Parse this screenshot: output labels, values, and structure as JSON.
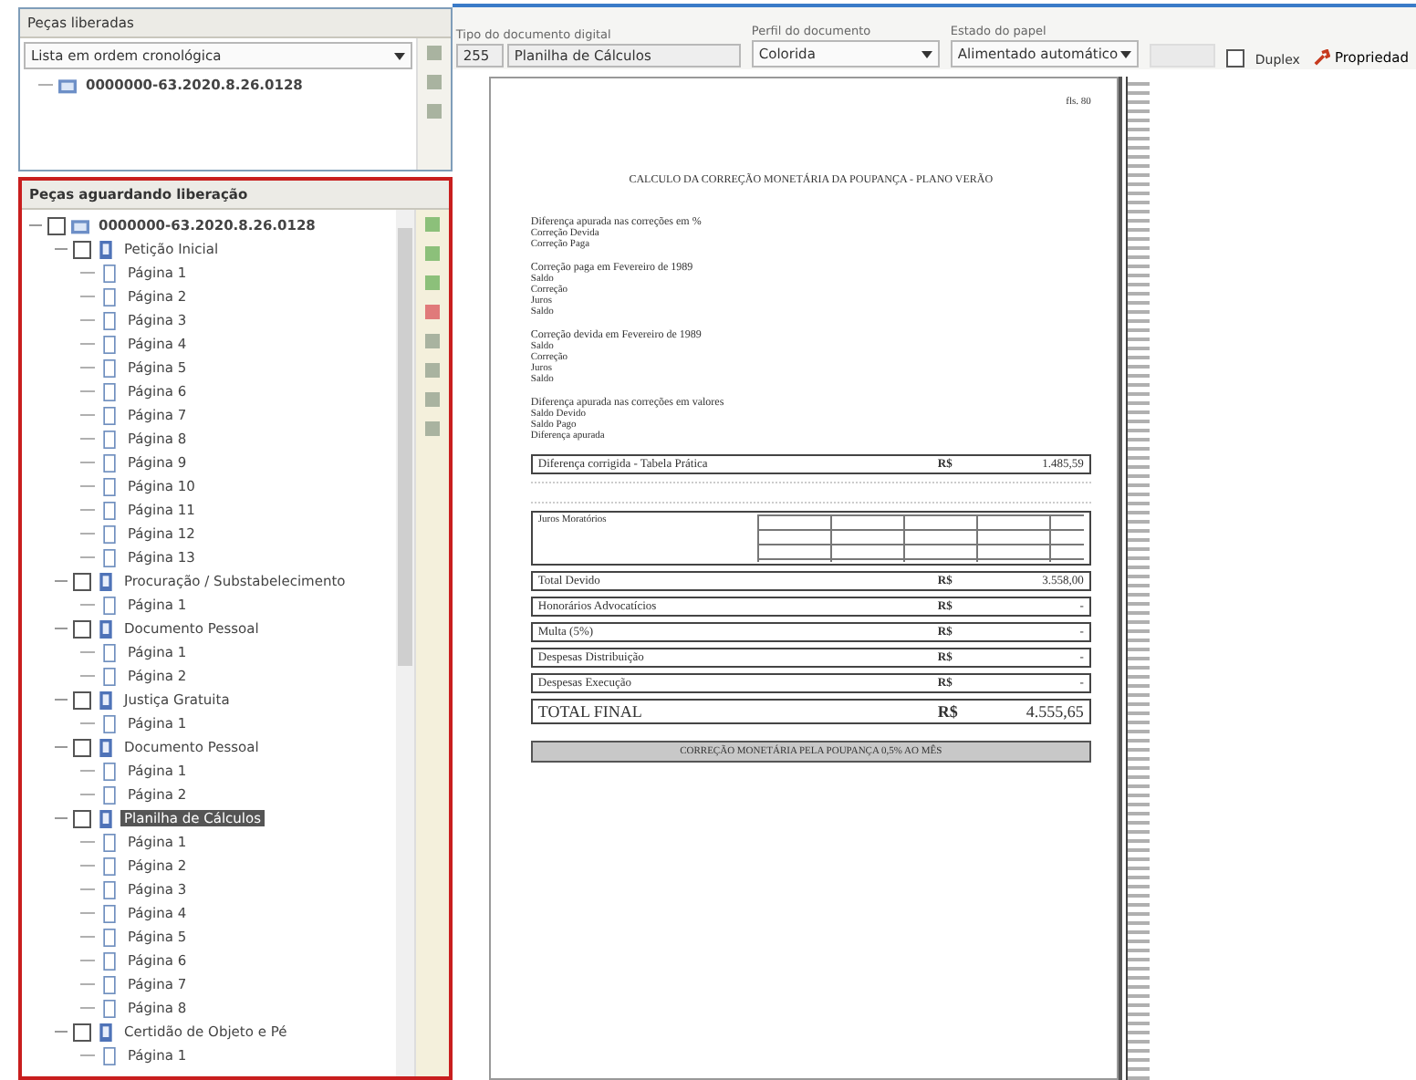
{
  "released_panel": {
    "title": "Peças liberadas",
    "sort": "Lista em ordem cronológica",
    "items": [
      {
        "label": "0000000-63.2020.8.26.0128",
        "selected": false
      }
    ]
  },
  "pending_panel": {
    "title": "Peças aguardando liberação",
    "tree": [
      {
        "kind": "process",
        "label": "0000000-63.2020.8.26.0128",
        "checked": false,
        "selected": false,
        "expanded": true,
        "children": [
          {
            "kind": "doc",
            "label": "Petição Inicial",
            "checked": false,
            "selected": false,
            "expanded": true,
            "children": [
              {
                "kind": "page",
                "label": "Página 1",
                "selected": false
              },
              {
                "kind": "page",
                "label": "Página 2",
                "selected": false
              },
              {
                "kind": "page",
                "label": "Página 3",
                "selected": false
              },
              {
                "kind": "page",
                "label": "Página 4",
                "selected": false
              },
              {
                "kind": "page",
                "label": "Página 5",
                "selected": false
              },
              {
                "kind": "page",
                "label": "Página 6",
                "selected": false
              },
              {
                "kind": "page",
                "label": "Página 7",
                "selected": false
              },
              {
                "kind": "page",
                "label": "Página 8",
                "selected": false
              },
              {
                "kind": "page",
                "label": "Página 9",
                "selected": false
              },
              {
                "kind": "page",
                "label": "Página 10",
                "selected": false
              },
              {
                "kind": "page",
                "label": "Página 11",
                "selected": false
              },
              {
                "kind": "page",
                "label": "Página 12",
                "selected": false
              },
              {
                "kind": "page",
                "label": "Página 13",
                "selected": false
              }
            ]
          },
          {
            "kind": "doc",
            "label": "Procuração / Substabelecimento",
            "checked": false,
            "selected": false,
            "expanded": true,
            "children": [
              {
                "kind": "page",
                "label": "Página 1",
                "selected": false
              }
            ]
          },
          {
            "kind": "doc",
            "label": "Documento Pessoal",
            "checked": false,
            "selected": false,
            "expanded": true,
            "children": [
              {
                "kind": "page",
                "label": "Página 1",
                "selected": false
              },
              {
                "kind": "page",
                "label": "Página 2",
                "selected": false
              }
            ]
          },
          {
            "kind": "doc",
            "label": "Justiça Gratuita",
            "checked": false,
            "selected": false,
            "expanded": true,
            "children": [
              {
                "kind": "page",
                "label": "Página 1",
                "selected": false
              }
            ]
          },
          {
            "kind": "doc",
            "label": "Documento Pessoal",
            "checked": false,
            "selected": false,
            "expanded": true,
            "children": [
              {
                "kind": "page",
                "label": "Página 1",
                "selected": false
              },
              {
                "kind": "page",
                "label": "Página 2",
                "selected": false
              }
            ]
          },
          {
            "kind": "doc",
            "label": "Planilha de Cálculos",
            "checked": false,
            "selected": true,
            "expanded": true,
            "children": [
              {
                "kind": "page",
                "label": "Página 1",
                "selected": false
              },
              {
                "kind": "page",
                "label": "Página 2",
                "selected": false
              },
              {
                "kind": "page",
                "label": "Página 3",
                "selected": false
              },
              {
                "kind": "page",
                "label": "Página 4",
                "selected": false
              },
              {
                "kind": "page",
                "label": "Página 5",
                "selected": false
              },
              {
                "kind": "page",
                "label": "Página 6",
                "selected": false
              },
              {
                "kind": "page",
                "label": "Página 7",
                "selected": false
              },
              {
                "kind": "page",
                "label": "Página 8",
                "selected": false
              }
            ]
          },
          {
            "kind": "doc",
            "label": "Certidão de Objeto e Pé",
            "checked": false,
            "selected": false,
            "expanded": true,
            "children": [
              {
                "kind": "page",
                "label": "Página 1",
                "selected": false
              }
            ]
          }
        ]
      }
    ]
  },
  "toolbar": {
    "type_label": "Tipo do documento digital",
    "type_code": "255",
    "type_name": "Planilha de Cálculos",
    "profile_label": "Perfil do documento",
    "profile": "Colorida",
    "state_label": "Estado do papel",
    "state": "Alimentado automático",
    "duplex": {
      "label": "Duplex",
      "checked": false
    },
    "properties": "Propriedad"
  },
  "document": {
    "page_number": "fls. 80",
    "title": "CALCULO DA CORREÇÃO MONETÁRIA DA POUPANÇA - PLANO VERÃO",
    "sections": [
      {
        "heading": "Diferença apurada nas correções em %",
        "rows": [
          "Correção Devida",
          "Correção Paga"
        ]
      },
      {
        "heading": "Correção paga em Fevereiro de 1989",
        "rows": [
          "Saldo",
          "Correção",
          "Juros",
          "Saldo"
        ]
      },
      {
        "heading": "Correção devida em Fevereiro de 1989",
        "rows": [
          "Saldo",
          "Correção",
          "Juros",
          "Saldo"
        ]
      },
      {
        "heading": "Diferença apurada nas correções em valores",
        "rows": [
          "Saldo Devido",
          "Saldo Pago",
          "Diferença apurada"
        ]
      }
    ],
    "corrected": {
      "label": "Diferença corrigida - Tabela Prática",
      "currency": "R$",
      "amount": "1.485,59"
    },
    "interest_label": "Juros Moratórios",
    "totals": [
      {
        "kind": "total",
        "label": "Total Devido",
        "currency": "R$",
        "amount": "3.558,00"
      },
      {
        "kind": "item",
        "label": "Honorários Advocatícios",
        "currency": "R$",
        "amount": "-"
      },
      {
        "kind": "item",
        "label": "Multa (5%)",
        "currency": "R$",
        "amount": "-"
      },
      {
        "kind": "item",
        "label": "Despesas Distribuição",
        "currency": "R$",
        "amount": "-"
      },
      {
        "kind": "item",
        "label": "Despesas Execução",
        "currency": "R$",
        "amount": "-"
      },
      {
        "kind": "final",
        "label": "TOTAL FINAL",
        "currency": "R$",
        "amount": "4.555,65"
      }
    ],
    "banner": "CORREÇÃO MONETÁRIA PELA POUPANÇA 0,5% AO MÊS"
  }
}
